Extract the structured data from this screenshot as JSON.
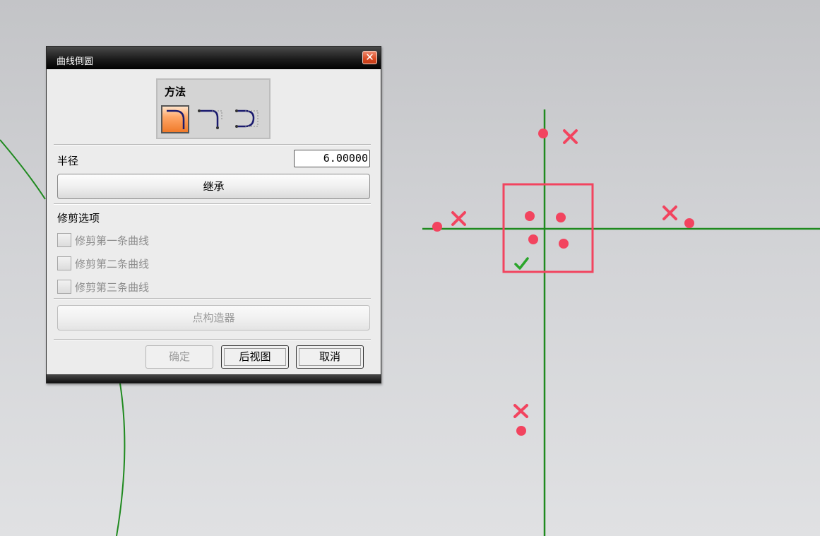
{
  "dialog": {
    "title": "曲线倒圆",
    "close_icon": "close-icon",
    "method": {
      "label": "方法",
      "options": [
        "fillet-circle-icon",
        "fillet-two-curves-icon",
        "fillet-three-curves-icon"
      ],
      "selected_index": 0
    },
    "radius": {
      "label": "半径",
      "value": "6.00000"
    },
    "inherit_button": "继承",
    "trim": {
      "label": "修剪选项",
      "options": [
        {
          "label": "修剪第一条曲线",
          "checked": false,
          "enabled": false
        },
        {
          "label": "修剪第二条曲线",
          "checked": false,
          "enabled": false
        },
        {
          "label": "修剪第三条曲线",
          "checked": false,
          "enabled": false
        }
      ]
    },
    "point_constructor_button": "点构造器",
    "buttons": {
      "ok": "确定",
      "back": "后视图",
      "cancel": "取消"
    },
    "colors": {
      "accent": "#f07a2a",
      "titlebar": "#1c1c1c",
      "close": "#d94a22"
    }
  },
  "canvas": {
    "colors": {
      "axis": "#1f8a1f",
      "marker": "#f2445f",
      "check": "#2aa52a"
    },
    "markers": [
      "marker-dot",
      "marker-cross",
      "selection-box",
      "check-icon"
    ]
  }
}
